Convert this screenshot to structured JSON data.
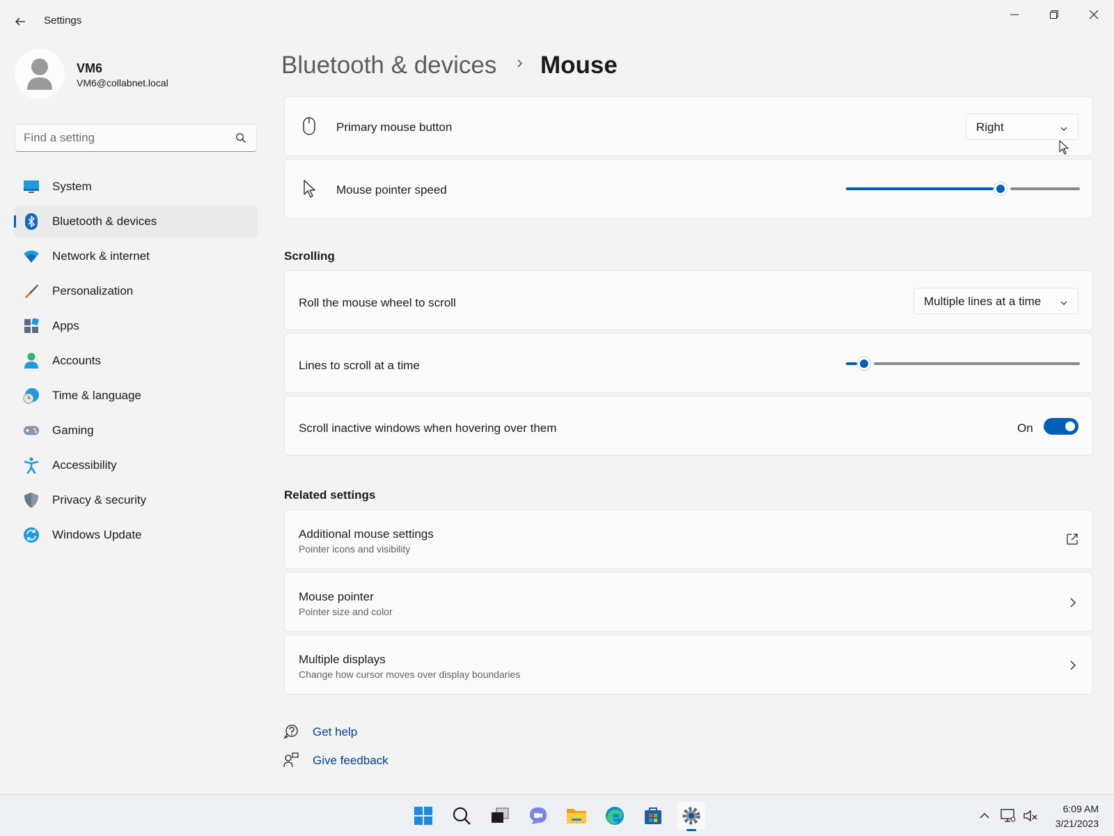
{
  "window": {
    "title": "Settings",
    "controls": [
      "minimize",
      "restore",
      "close"
    ]
  },
  "user": {
    "name": "VM6",
    "email": "VM6@collabnet.local"
  },
  "search": {
    "placeholder": "Find a setting"
  },
  "sidebar": {
    "items": [
      {
        "label": "System",
        "icon": "system-icon"
      },
      {
        "label": "Bluetooth & devices",
        "icon": "bluetooth-icon",
        "active": true
      },
      {
        "label": "Network & internet",
        "icon": "wifi-icon"
      },
      {
        "label": "Personalization",
        "icon": "brush-icon"
      },
      {
        "label": "Apps",
        "icon": "apps-icon"
      },
      {
        "label": "Accounts",
        "icon": "accounts-icon"
      },
      {
        "label": "Time & language",
        "icon": "globe-clock-icon"
      },
      {
        "label": "Gaming",
        "icon": "gamepad-icon"
      },
      {
        "label": "Accessibility",
        "icon": "accessibility-icon"
      },
      {
        "label": "Privacy & security",
        "icon": "shield-icon"
      },
      {
        "label": "Windows Update",
        "icon": "update-icon"
      }
    ]
  },
  "breadcrumb": {
    "parent": "Bluetooth & devices",
    "current": "Mouse"
  },
  "settings": {
    "primary_button": {
      "label": "Primary mouse button",
      "value": "Right"
    },
    "pointer_speed": {
      "label": "Mouse pointer speed",
      "value_fraction": 0.67
    },
    "scrolling_title": "Scrolling",
    "roll_wheel": {
      "label": "Roll the mouse wheel to scroll",
      "value": "Multiple lines at a time"
    },
    "lines_to_scroll": {
      "label": "Lines to scroll at a time",
      "value_fraction": 0.05
    },
    "scroll_inactive": {
      "label": "Scroll inactive windows when hovering over them",
      "state": "On"
    }
  },
  "related": {
    "title": "Related settings",
    "items": [
      {
        "label": "Additional mouse settings",
        "sub": "Pointer icons and visibility",
        "icon": "external-link-icon"
      },
      {
        "label": "Mouse pointer",
        "sub": "Pointer size and color",
        "icon": "chevron-right-icon"
      },
      {
        "label": "Multiple displays",
        "sub": "Change how cursor moves over display boundaries",
        "icon": "chevron-right-icon"
      }
    ]
  },
  "help_links": {
    "get_help": "Get help",
    "give_feedback": "Give feedback"
  },
  "taskbar": {
    "apps": [
      "start-icon",
      "search-icon",
      "task-view-icon",
      "chat-icon",
      "file-explorer-icon",
      "edge-icon",
      "store-icon",
      "settings-icon"
    ],
    "time": "6:09 AM",
    "date": "3/21/2023"
  },
  "colors": {
    "accent": "#005fb8",
    "link": "#003e92",
    "background": "#f3f3f3",
    "card": "#fbfbfb"
  }
}
